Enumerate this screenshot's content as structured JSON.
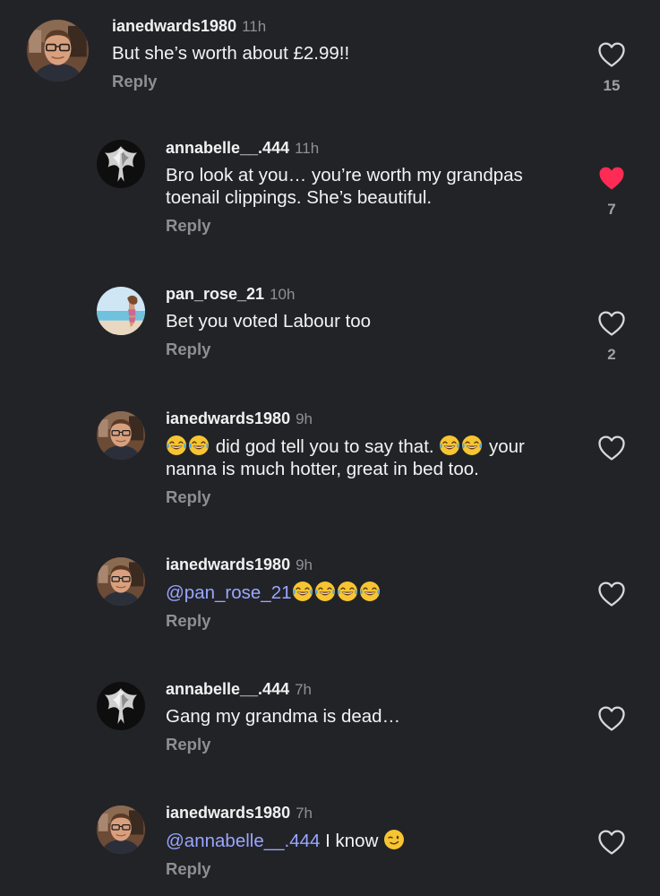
{
  "colors": {
    "background": "#222327",
    "mention": "#9aa6ff",
    "liked_heart": "#fe2c55",
    "muted_text": "#8e8f95"
  },
  "reply_label": "Reply",
  "comments": [
    {
      "username": "ianedwards1980",
      "time": "11h",
      "text": "But she’s worth about £2.99!!",
      "likes": "15",
      "liked": false,
      "avatar_icon": "man-with-glasses-avatar"
    },
    {
      "username": "annabelle__.444",
      "time": "11h",
      "text": "Bro look at you… you’re worth my grandpas toenail clippings. She’s beautiful.",
      "likes": "7",
      "liked": true,
      "avatar_icon": "eagle-avatar"
    },
    {
      "username": "pan_rose_21",
      "time": "10h",
      "text": "Bet you voted Labour too",
      "likes": "2",
      "liked": false,
      "avatar_icon": "beach-avatar"
    },
    {
      "username": "ianedwards1980",
      "time": "9h",
      "text_part1": "did god tell you to say that.",
      "text_part2": "your nanna is much hotter, great in bed too.",
      "likes": "",
      "liked": false,
      "avatar_icon": "man-with-glasses-avatar",
      "emoji": "face-with-tears-of-joy-icon"
    },
    {
      "username": "ianedwards1980",
      "time": "9h",
      "mention": "@pan_rose_21",
      "likes": "",
      "liked": false,
      "avatar_icon": "man-with-glasses-avatar",
      "emoji": "face-with-tears-of-joy-icon"
    },
    {
      "username": "annabelle__.444",
      "time": "7h",
      "text": "Gang my grandma is dead…",
      "likes": "",
      "liked": false,
      "avatar_icon": "eagle-avatar"
    },
    {
      "username": "ianedwards1980",
      "time": "7h",
      "mention": "@annabelle__.444",
      "text": "I know",
      "likes": "",
      "liked": false,
      "avatar_icon": "man-with-glasses-avatar",
      "emoji": "winking-face-icon"
    }
  ]
}
